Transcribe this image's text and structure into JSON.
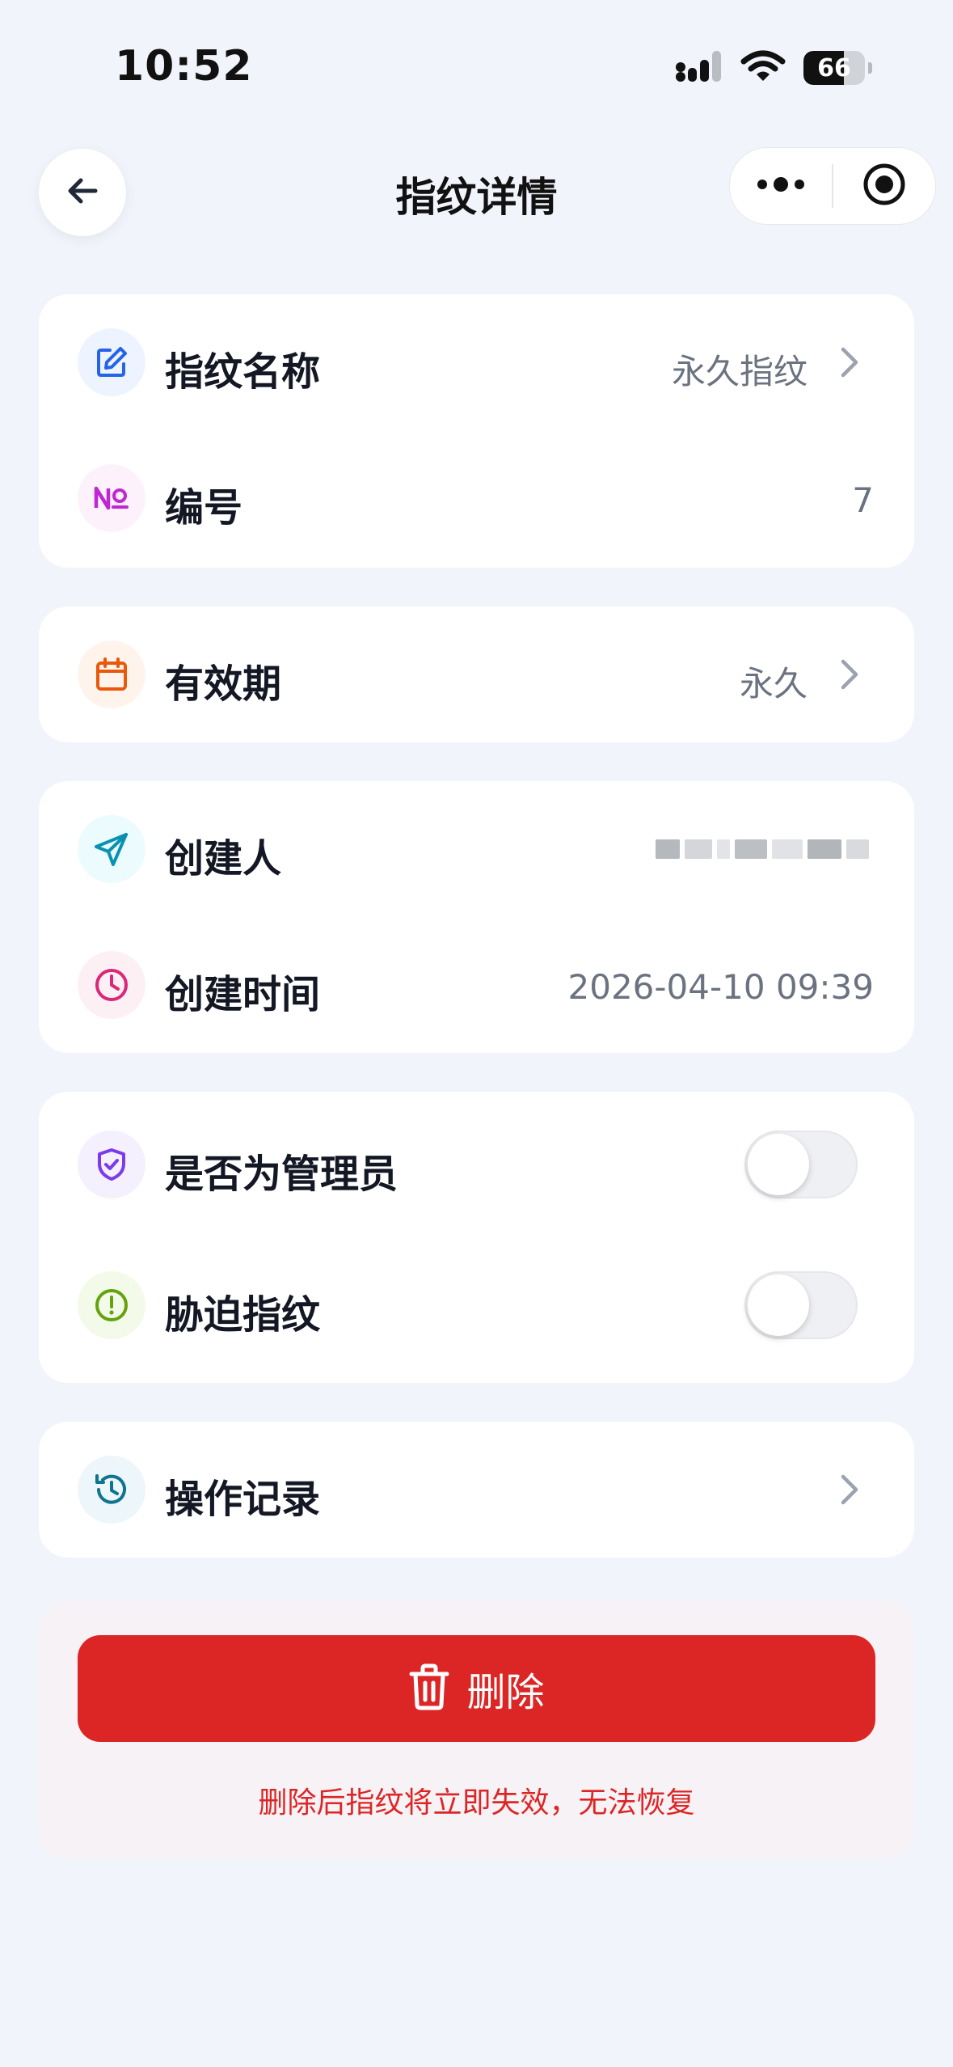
{
  "status_bar": {
    "time": "10:52",
    "battery_level": "66",
    "icons": [
      "cellular-signal-icon",
      "wifi-icon",
      "battery-icon"
    ]
  },
  "nav": {
    "title": "指纹详情",
    "back_icon": "arrow-left-icon",
    "more_icon": "more-dots-icon",
    "close_icon": "target-circle-icon"
  },
  "info_card": {
    "name_label": "指纹名称",
    "name_value": "永久指纹",
    "number_label": "编号",
    "number_value": "7"
  },
  "validity_card": {
    "label": "有效期",
    "value": "永久"
  },
  "creator_card": {
    "creator_label": "创建人",
    "created_time_label": "创建时间",
    "created_time_value": "2026-04-10 09:39"
  },
  "toggles_card": {
    "admin_label": "是否为管理员",
    "admin_on": false,
    "duress_label": "胁迫指纹",
    "duress_on": false
  },
  "log_card": {
    "label": "操作记录"
  },
  "delete": {
    "button_label": "删除",
    "hint": "删除后指纹将立即失效，无法恢复"
  },
  "colors": {
    "background": "#f1f4fb",
    "danger": "#dc2626",
    "edit_icon": "#2563eb",
    "number_icon": "#c026d3",
    "calendar_icon": "#ea580c",
    "send_icon": "#0891b2",
    "clock_icon": "#db2777",
    "shield_icon": "#7c3aed",
    "alert_icon": "#65a30d",
    "history_icon": "#0e7490"
  }
}
